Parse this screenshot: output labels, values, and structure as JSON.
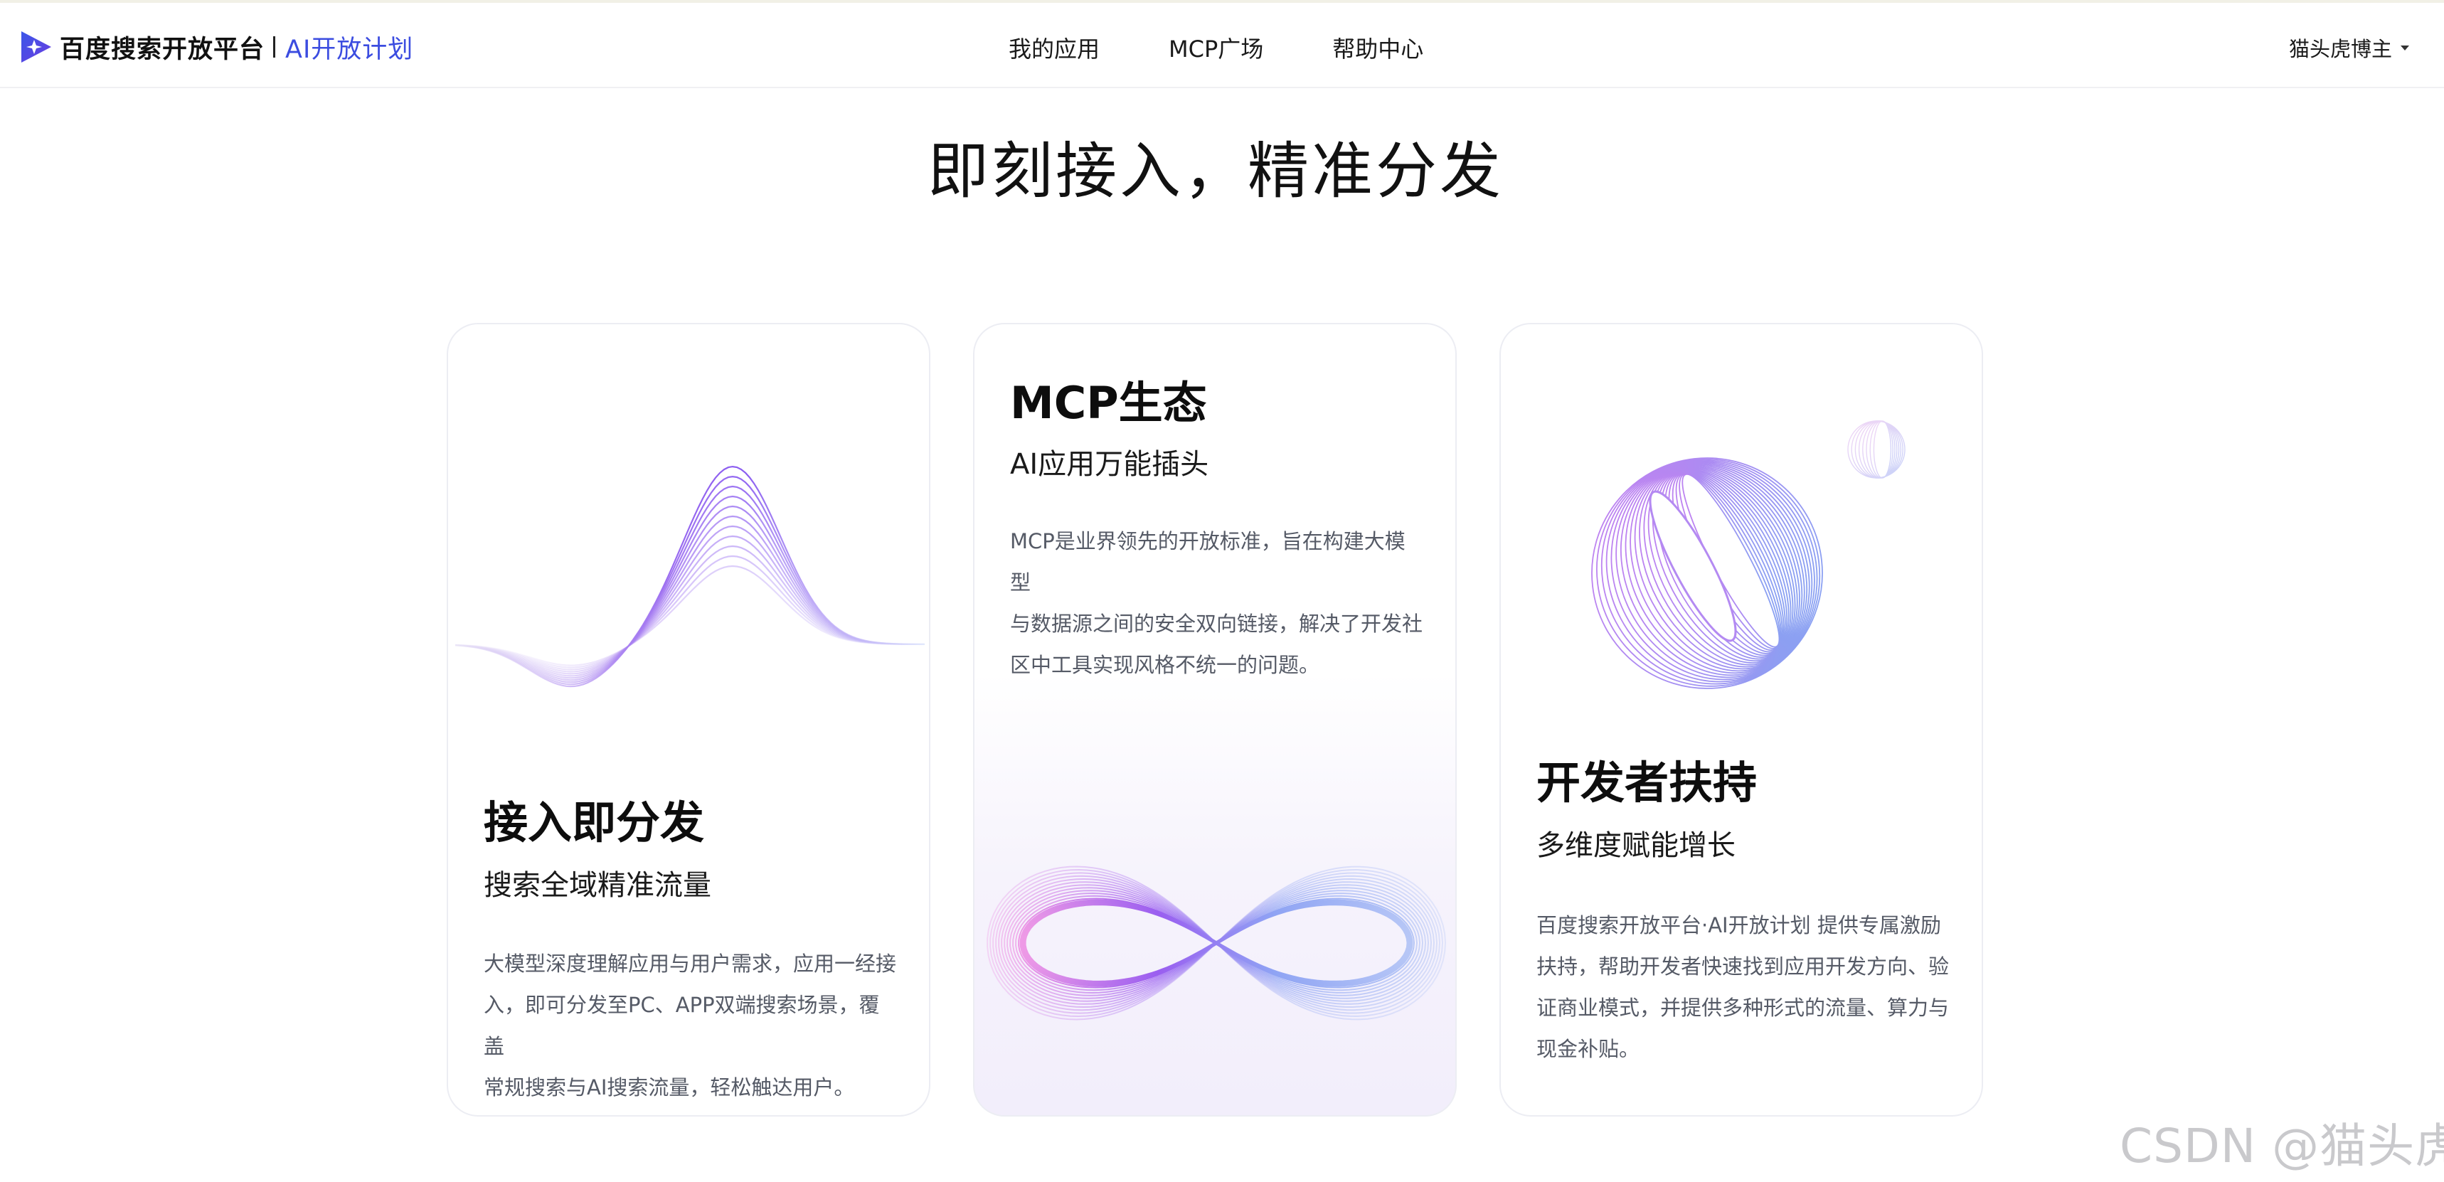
{
  "header": {
    "brand_name": "百度搜索开放平台",
    "brand_plan": "AI开放计划",
    "nav": [
      {
        "label": "我的应用"
      },
      {
        "label": "MCP广场"
      },
      {
        "label": "帮助中心"
      }
    ],
    "user_name": "猫头虎博主"
  },
  "main": {
    "headline": "即刻接入，精准分发",
    "cards": [
      {
        "title": "接入即分发",
        "subtitle": "搜索全域精准流量",
        "desc_lines": [
          "大模型深度理解应用与用户需求，应用一经接",
          "入，即可分发至PC、APP双端搜索场景，覆盖",
          "常规搜索与AI搜索流量，轻松触达用户。"
        ]
      },
      {
        "title": "MCP生态",
        "subtitle": "AI应用万能插头",
        "desc_lines": [
          "MCP是业界领先的开放标准，旨在构建大模型",
          "与数据源之间的安全双向链接，解决了开发社",
          "区中工具实现风格不统一的问题。"
        ]
      },
      {
        "title": "开发者扶持",
        "subtitle": "多维度赋能增长",
        "desc_lines": [
          "百度搜索开放平台·AI开放计划 提供专属激励",
          "扶持，帮助开发者快速找到应用开发方向、验",
          "证商业模式，并提供多种形式的流量、算力与",
          "现金补贴。"
        ]
      }
    ]
  },
  "watermark": "CSDN @猫头虎",
  "colors": {
    "brand_blue": "#3b4ce0",
    "accent_purple": "#8b5cf6",
    "accent_blue": "#7aa7f0",
    "accent_pink": "#e58be0"
  },
  "icons": [
    "baidu-spark-logo-icon",
    "caret-down-icon"
  ]
}
